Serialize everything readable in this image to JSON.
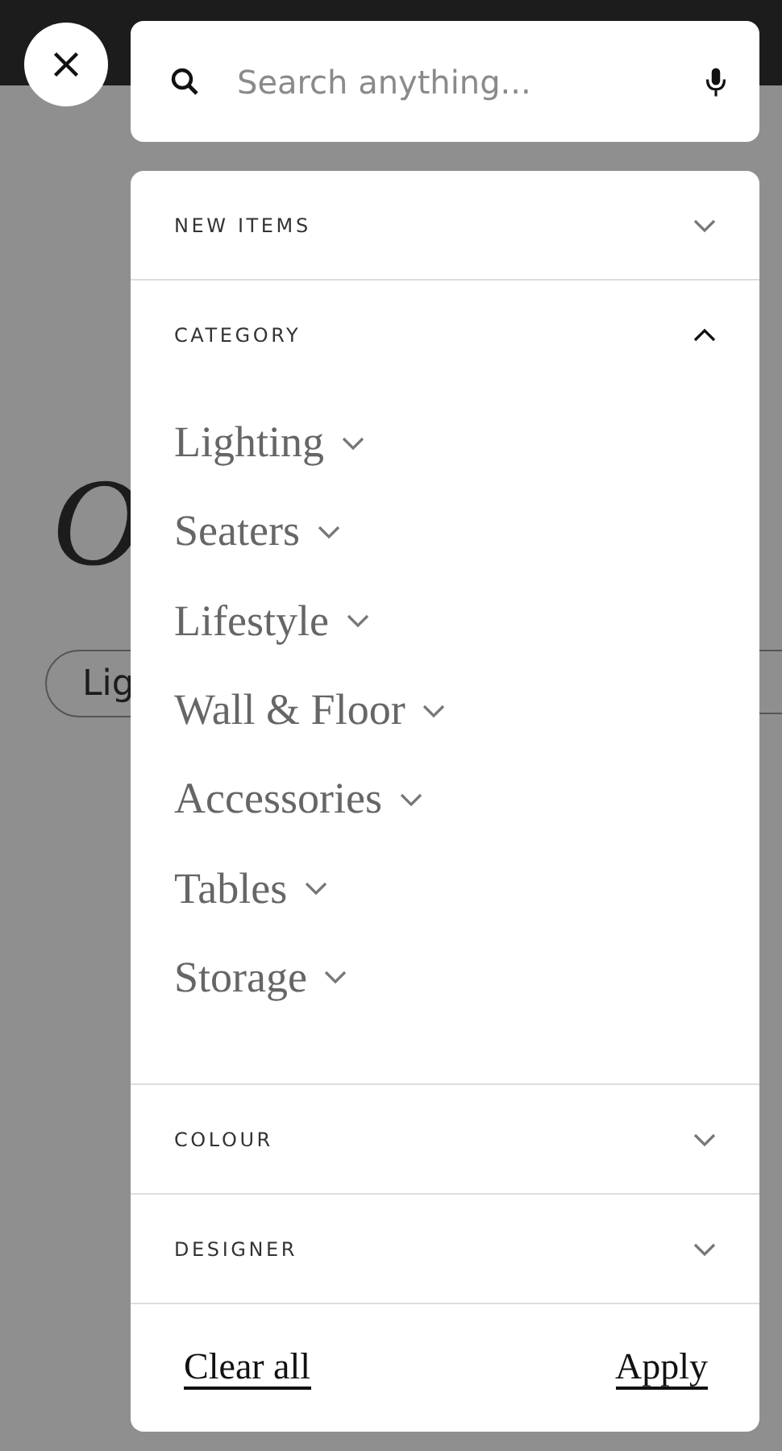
{
  "background": {
    "heading": "O",
    "chips": [
      "Lig"
    ]
  },
  "search": {
    "placeholder": "Search anything..."
  },
  "filters": [
    {
      "title": "NEW ITEMS",
      "expanded": false
    },
    {
      "title": "CATEGORY",
      "expanded": true,
      "items": [
        {
          "label": "Lighting",
          "expanded": false
        },
        {
          "label": "Seaters",
          "expanded": false
        },
        {
          "label": "Lifestyle",
          "expanded": false
        },
        {
          "label": "Wall & Floor",
          "expanded": false
        },
        {
          "label": "Accessories",
          "expanded": false
        },
        {
          "label": "Tables",
          "expanded": false
        },
        {
          "label": "Storage",
          "expanded": false
        }
      ]
    },
    {
      "title": "COLOUR",
      "expanded": false
    },
    {
      "title": "DESIGNER",
      "expanded": false
    }
  ],
  "footer": {
    "clear": "Clear all",
    "apply": "Apply"
  }
}
